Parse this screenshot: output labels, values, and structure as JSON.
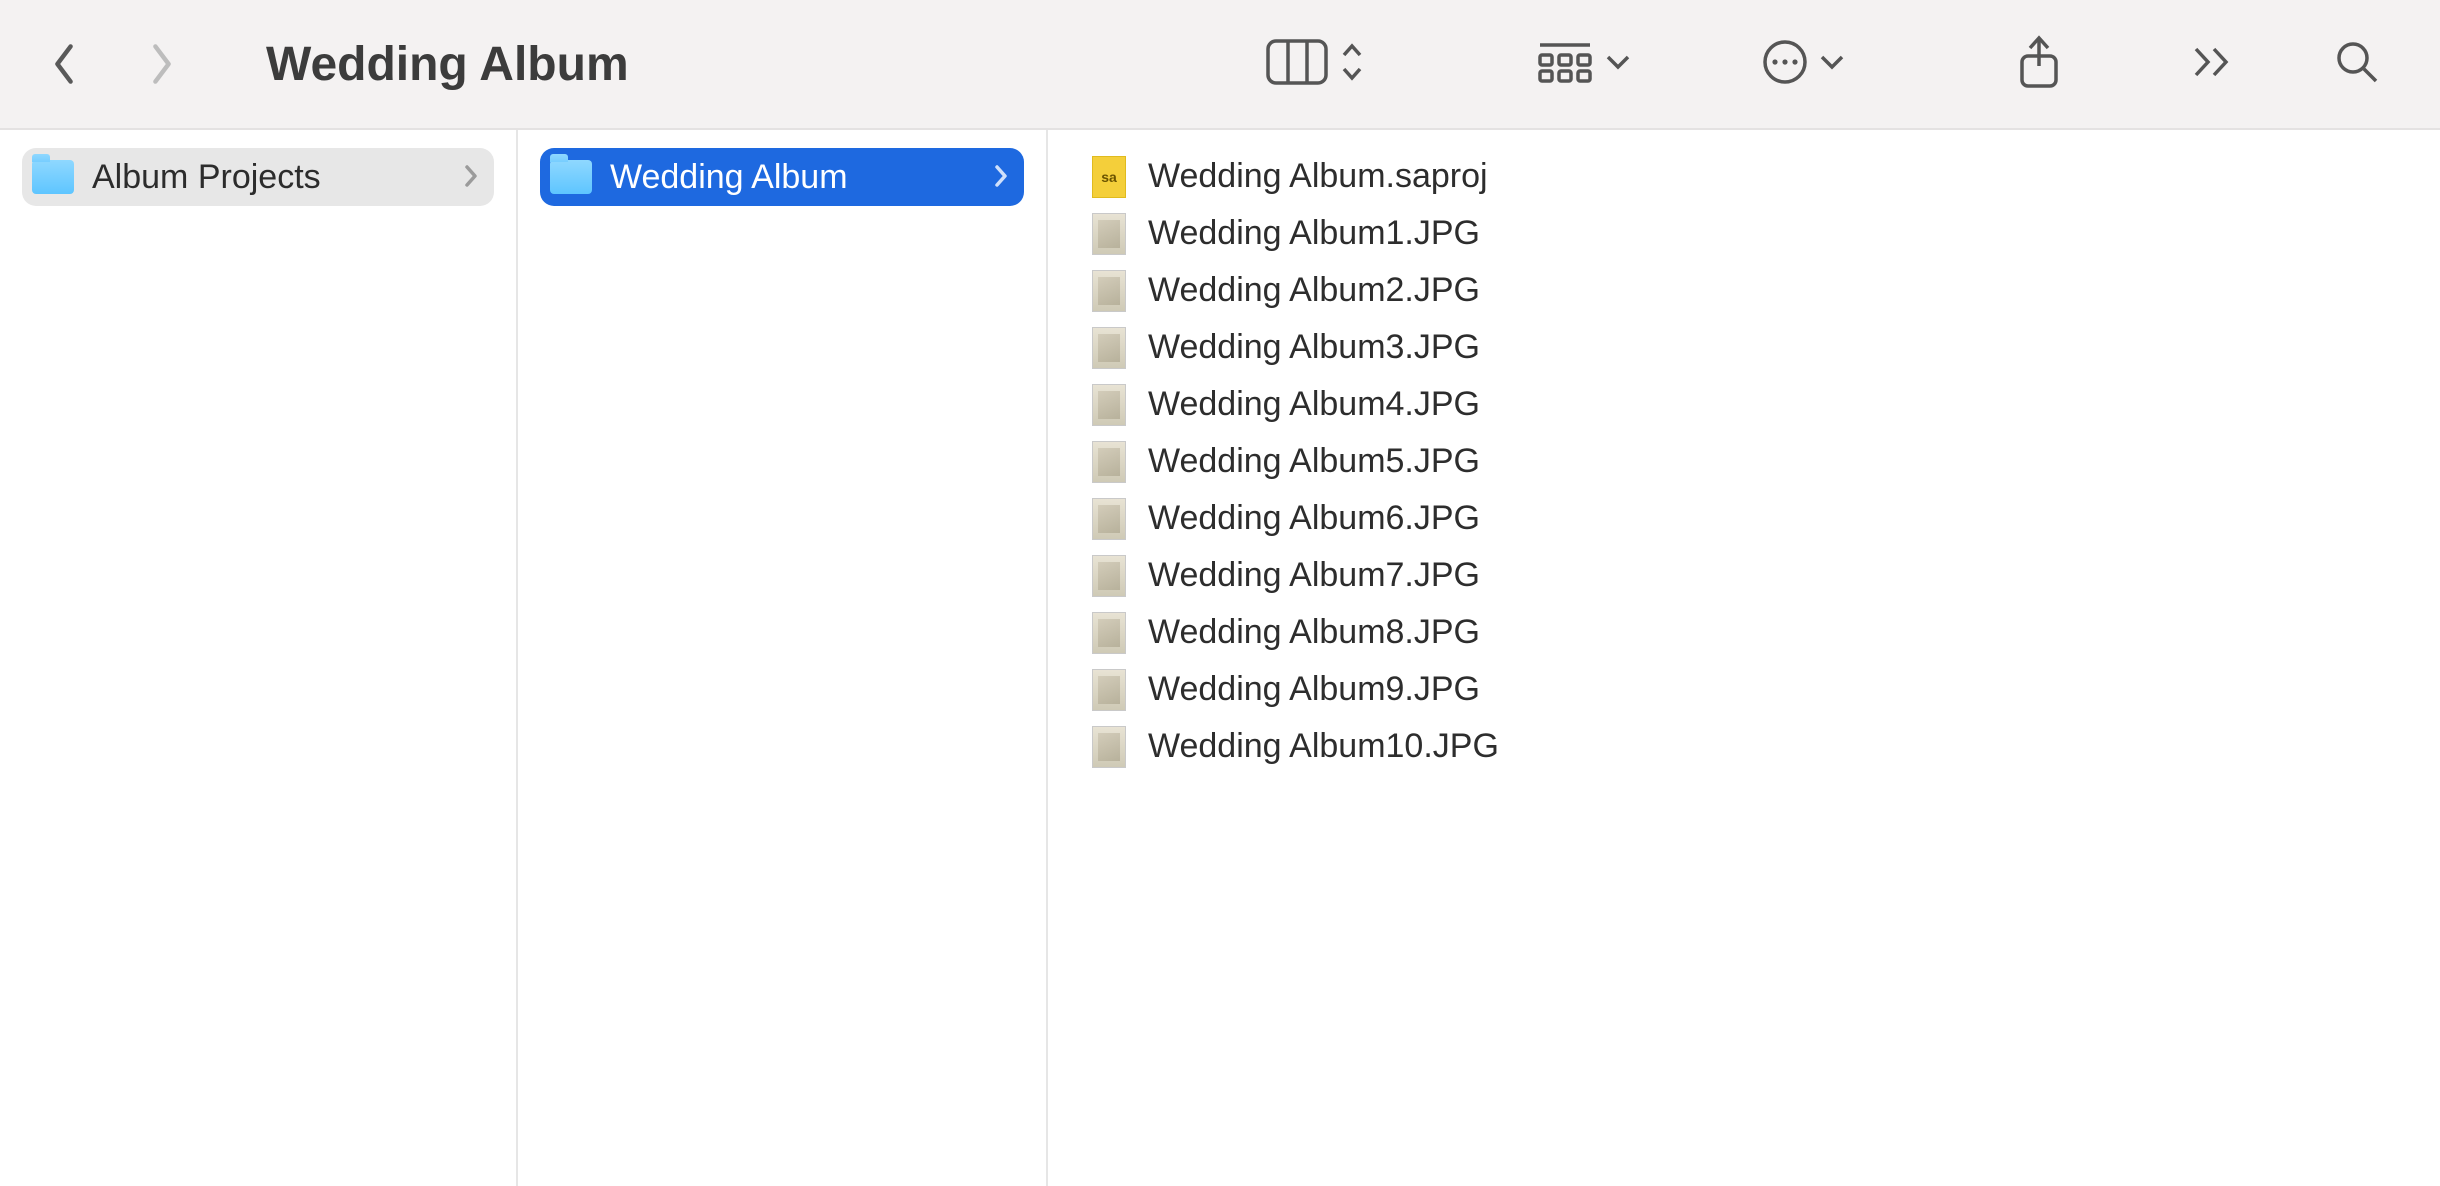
{
  "window_title": "Wedding Album",
  "columns": {
    "col1": [
      {
        "name": "Album Projects",
        "type": "folder",
        "selected": false,
        "hovered": true
      }
    ],
    "col2": [
      {
        "name": "Wedding Album",
        "type": "folder",
        "selected": true
      }
    ],
    "col3": [
      {
        "name": "Wedding Album.saproj",
        "type": "saproj"
      },
      {
        "name": "Wedding Album1.JPG",
        "type": "jpg"
      },
      {
        "name": "Wedding Album2.JPG",
        "type": "jpg"
      },
      {
        "name": "Wedding Album3.JPG",
        "type": "jpg"
      },
      {
        "name": "Wedding Album4.JPG",
        "type": "jpg"
      },
      {
        "name": "Wedding Album5.JPG",
        "type": "jpg"
      },
      {
        "name": "Wedding Album6.JPG",
        "type": "jpg"
      },
      {
        "name": "Wedding Album7.JPG",
        "type": "jpg"
      },
      {
        "name": "Wedding Album8.JPG",
        "type": "jpg"
      },
      {
        "name": "Wedding Album9.JPG",
        "type": "jpg"
      },
      {
        "name": "Wedding Album10.JPG",
        "type": "jpg"
      }
    ]
  },
  "toolbar": {
    "back_enabled": true,
    "forward_enabled": false
  }
}
